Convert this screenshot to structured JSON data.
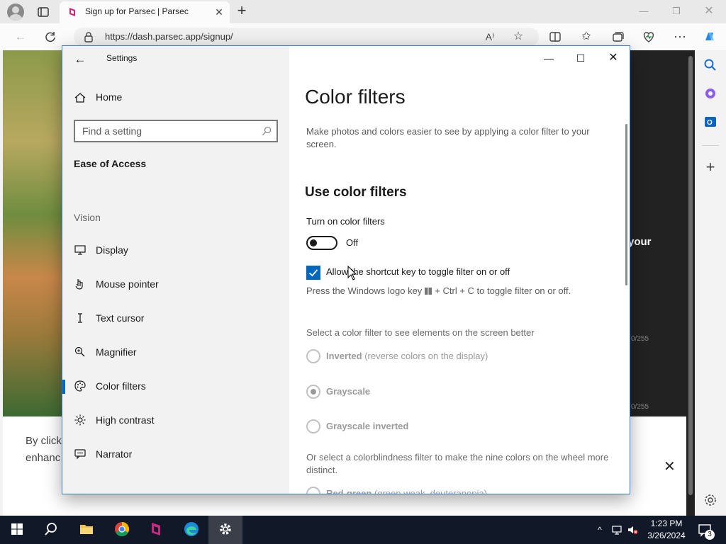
{
  "browser": {
    "tab_title": "Sign up for Parsec | Parsec",
    "tab_close": "✕",
    "new_tab": "+",
    "url": "https://dash.parsec.app/signup/"
  },
  "page": {
    "hero_text": "your",
    "char_count_1": "0/255",
    "char_count_2": "0/255",
    "consent_line1": "By click",
    "consent_line2": "enhanc",
    "consent_close": "✕"
  },
  "settings": {
    "window_title": "Settings",
    "home_label": "Home",
    "search_placeholder": "Find a setting",
    "group_title": "Ease of Access",
    "section_vision": "Vision",
    "nav_items": [
      {
        "label": "Display",
        "icon": "monitor-icon"
      },
      {
        "label": "Mouse pointer",
        "icon": "mouse-pointer-icon"
      },
      {
        "label": "Text cursor",
        "icon": "text-cursor-icon"
      },
      {
        "label": "Magnifier",
        "icon": "magnifier-icon"
      },
      {
        "label": "Color filters",
        "icon": "palette-icon",
        "active": true
      },
      {
        "label": "High contrast",
        "icon": "sun-icon"
      },
      {
        "label": "Narrator",
        "icon": "narrator-icon"
      }
    ],
    "content": {
      "heading": "Color filters",
      "description": "Make photos and colors easier to see by applying a color filter to your screen.",
      "subheading": "Use color filters",
      "turn_on_label": "Turn on color filters",
      "toggle_state": "Off",
      "toggle_on": false,
      "shortcut_checkbox_label": "Allow the shortcut key to toggle filter on or off",
      "shortcut_checked": true,
      "shortcut_hint_pre": "Press the Windows logo key",
      "shortcut_hint_post": "+ Ctrl + C to toggle filter on or off.",
      "select_prompt": "Select a color filter to see elements on the screen better",
      "filters": [
        {
          "name": "Inverted",
          "note": "(reverse colors on the display)",
          "selected": false
        },
        {
          "name": "Grayscale",
          "note": "",
          "selected": true
        },
        {
          "name": "Grayscale inverted",
          "note": "",
          "selected": false
        }
      ],
      "colorblind_prompt": "Or select a colorblindness filter to make the nine colors on the wheel more distinct.",
      "partial_option_name": "Red-green",
      "partial_option_note": "(green weak, deuteranopia)"
    }
  },
  "taskbar": {
    "time": "1:23 PM",
    "date": "3/26/2024",
    "notification_count": "3"
  },
  "colors": {
    "accent": "#0067c0",
    "taskbar": "#111827",
    "window_border": "#3b7bcf"
  }
}
